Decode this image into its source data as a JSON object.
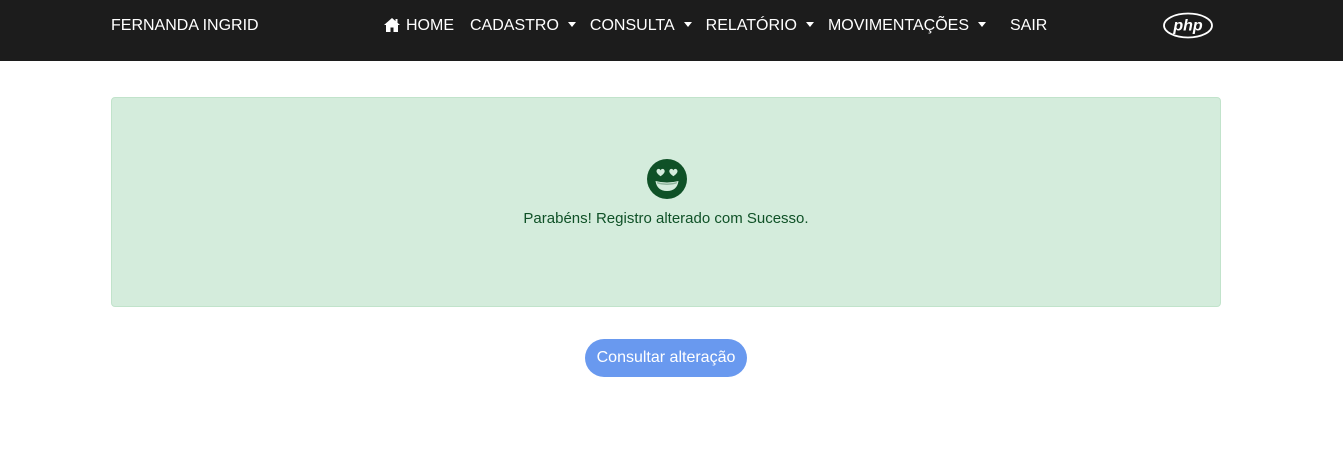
{
  "navbar": {
    "brand": "FERNANDA INGRID",
    "items": [
      {
        "label": "HOME",
        "icon": "home-icon",
        "dropdown": false
      },
      {
        "label": "CADASTRO",
        "dropdown": true
      },
      {
        "label": "CONSULTA",
        "dropdown": true
      },
      {
        "label": "RELATÓRIO",
        "dropdown": true
      },
      {
        "label": "MOVIMENTAÇÕES",
        "dropdown": true
      },
      {
        "label": "SAIR",
        "dropdown": false
      }
    ],
    "logo_text": "php",
    "background_color": "#1c1c1c"
  },
  "alert": {
    "icon": "grin-hearts-icon",
    "message": "Parabéns! Registro alterado com Sucesso.",
    "background_color": "#d4ecdc",
    "text_color": "#0f5127"
  },
  "action": {
    "button_label": "Consultar alteração",
    "button_color": "#6999ef"
  }
}
